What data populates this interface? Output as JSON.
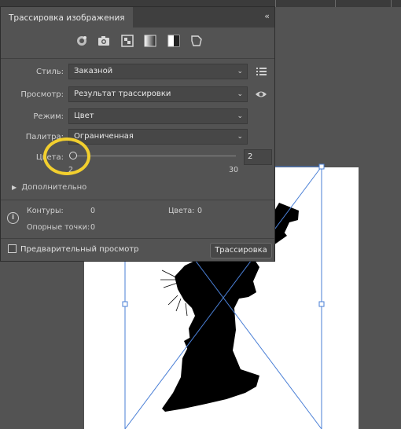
{
  "panel": {
    "title": "Трассировка изображения",
    "collapse_glyph": "‹‹",
    "preset_icons": [
      "auto-color-icon",
      "high-color-icon",
      "low-color-icon",
      "grayscale-icon",
      "black-white-icon",
      "outline-icon"
    ]
  },
  "fields": {
    "style_label": "Стиль:",
    "style_value": "Заказной",
    "view_label": "Просмотр:",
    "view_value": "Результат трассировки",
    "mode_label": "Режим:",
    "mode_value": "Цвет",
    "palette_label": "Палитра:",
    "palette_value": "Ограниченная",
    "colors_label": "Цвета:",
    "colors_value": "2",
    "colors_min": "2",
    "colors_max": "30",
    "colors_fraction": 0.0
  },
  "advanced_label": "Дополнительно",
  "stats": {
    "paths_label": "Контуры:",
    "paths_value": "0",
    "colors_label": "Цвета:",
    "colors_value": "0",
    "anchors_label": "Опорные точки:",
    "anchors_value": "0"
  },
  "preview_label": "Предварительный просмотр",
  "trace_button": "Трассировка",
  "chevron": "⌄",
  "accent_color": "#f2cf2e"
}
